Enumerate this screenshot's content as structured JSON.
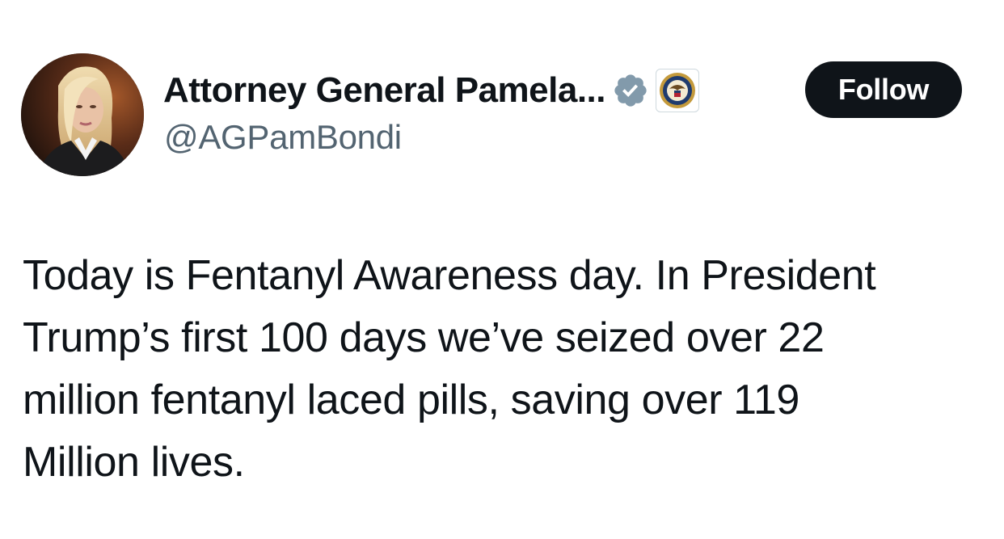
{
  "author": {
    "display_name": "Attorney General Pamela...",
    "handle": "@AGPamBondi",
    "avatar_icon": "profile-photo",
    "verified_icon": "verified-badge-icon",
    "affiliate_icon": "department-of-justice-seal-icon"
  },
  "actions": {
    "follow_label": "Follow"
  },
  "tweet": {
    "lines": [
      "Today is Fentanyl Awareness day. In President",
      "Trump’s first 100 days we’ve seized over 22",
      "million fentanyl laced pills, saving over 119",
      "Million lives."
    ]
  },
  "colors": {
    "text_primary": "#0f1419",
    "text_secondary": "#536471",
    "follow_bg": "#0f1419",
    "verified_badge": "#829aab"
  }
}
